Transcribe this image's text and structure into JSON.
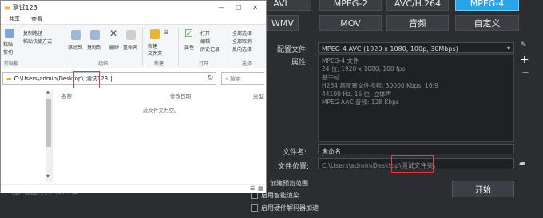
{
  "converter": {
    "formats_row1": [
      "AVI",
      "MPEG-2",
      "AVC/H.264",
      "MPEG-4"
    ],
    "formats_row2": [
      "WMV",
      "MOV",
      "音频",
      "自定义"
    ],
    "config_label": "配置文件:",
    "config_value": "MPEG-4 AVC (1920 x 1080, 100p, 30Mbps)",
    "props_label": "属性:",
    "props_lines": [
      "MPEG-4 文件",
      "24 位, 1920 x 1080, 100 fps",
      "基于帧",
      "H264 高配置文件视频: 30000 Kbps, 16:9",
      "44100 Hz, 16 位, 立体声",
      "MPEG AAC 音频: 128 Kbps"
    ],
    "filename_label": "文件名:",
    "filename_value": "未命名",
    "location_label": "文件位置:",
    "location_value": "C:\\Users\\admin\\Desktop\\测试文件夹\\",
    "opt_preview": "创建预览范围",
    "opt_smart": "启用智能渲染",
    "opt_hw": "启用硬件解码器加速",
    "start_label": "开始",
    "bottom_left_text": "估计输出大小: 467 MB",
    "colors": {
      "active_format": "#2aa4e6",
      "highlight": "#e23b3b"
    }
  },
  "explorer": {
    "title": "测试123",
    "tabs": [
      "共享",
      "查看"
    ],
    "ribbon": {
      "copy_path": "复制路径",
      "paste_shortcut": "粘贴快捷方式",
      "paste": "粘贴",
      "cut": "剪切",
      "clipboard_group": "剪贴板",
      "move_to": "移动到",
      "copy_to": "复制到",
      "delete": "删除",
      "rename": "重命名",
      "organize_group": "组织",
      "new_folder": "新建\n文件夹",
      "new_group": "新建",
      "properties": "属性",
      "open": "打开",
      "edit": "编辑",
      "history": "历史记录",
      "open_group": "打开",
      "select_all": "全部选择",
      "select_none": "全部取消",
      "invert": "反向选择",
      "select_group": "选择"
    },
    "address_prefix": "C:\\Users\\admin\\Desktop\\",
    "address_current": "测试123",
    "search_placeholder": "搜索",
    "columns": [
      "名称",
      "修改日期",
      "类型"
    ],
    "empty_text": "此文件夹为空。",
    "status": ""
  }
}
